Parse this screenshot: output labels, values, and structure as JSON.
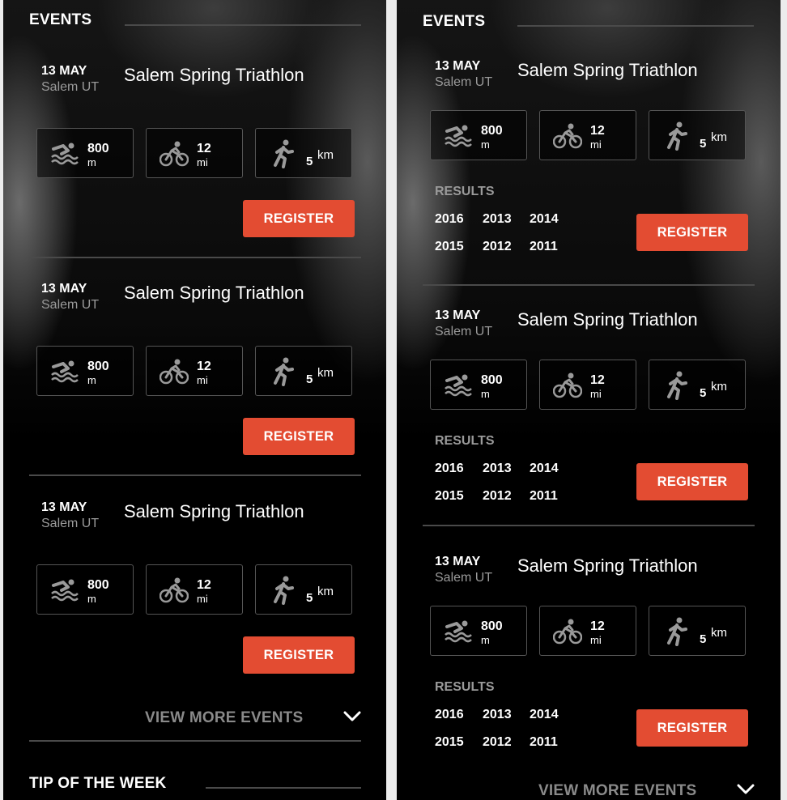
{
  "colors": {
    "accent": "#e34c32",
    "panel_bg": "#000000",
    "muted": "#9a9a9a"
  },
  "icons": {
    "swim": "swim-icon",
    "bike": "bike-icon",
    "run": "run-icon",
    "chevron": "chevron-down-icon"
  },
  "left": {
    "section_title": "EVENTS",
    "events": [
      {
        "date": "13 MAY",
        "location": "Salem UT",
        "title": "Salem Spring Triathlon",
        "swim": {
          "value": "800",
          "unit": "m"
        },
        "bike": {
          "value": "12",
          "unit": "mi"
        },
        "run": {
          "value": "5",
          "unit": "km"
        },
        "register": "REGISTER"
      },
      {
        "date": "13 MAY",
        "location": "Salem UT",
        "title": "Salem Spring Triathlon",
        "swim": {
          "value": "800",
          "unit": "m"
        },
        "bike": {
          "value": "12",
          "unit": "mi"
        },
        "run": {
          "value": "5",
          "unit": "km"
        },
        "register": "REGISTER"
      },
      {
        "date": "13 MAY",
        "location": "Salem UT",
        "title": "Salem Spring Triathlon",
        "swim": {
          "value": "800",
          "unit": "m"
        },
        "bike": {
          "value": "12",
          "unit": "mi"
        },
        "run": {
          "value": "5",
          "unit": "km"
        },
        "register": "REGISTER"
      }
    ],
    "view_more": "VIEW MORE EVENTS",
    "tip_title": "TIP OF THE WEEK"
  },
  "right": {
    "section_title": "EVENTS",
    "events": [
      {
        "date": "13 MAY",
        "location": "Salem UT",
        "title": "Salem Spring Triathlon",
        "swim": {
          "value": "800",
          "unit": "m"
        },
        "bike": {
          "value": "12",
          "unit": "mi"
        },
        "run": {
          "value": "5",
          "unit": "km"
        },
        "results_label": "RESULTS",
        "years": [
          "2016",
          "2013",
          "2014",
          "2015",
          "2012",
          "2011"
        ],
        "register": "REGISTER"
      },
      {
        "date": "13 MAY",
        "location": "Salem UT",
        "title": "Salem Spring Triathlon",
        "swim": {
          "value": "800",
          "unit": "m"
        },
        "bike": {
          "value": "12",
          "unit": "mi"
        },
        "run": {
          "value": "5",
          "unit": "km"
        },
        "results_label": "RESULTS",
        "years": [
          "2016",
          "2013",
          "2014",
          "2015",
          "2012",
          "2011"
        ],
        "register": "REGISTER"
      },
      {
        "date": "13 MAY",
        "location": "Salem UT",
        "title": "Salem Spring Triathlon",
        "swim": {
          "value": "800",
          "unit": "m"
        },
        "bike": {
          "value": "12",
          "unit": "mi"
        },
        "run": {
          "value": "5",
          "unit": "km"
        },
        "results_label": "RESULTS",
        "years": [
          "2016",
          "2013",
          "2014",
          "2015",
          "2012",
          "2011"
        ],
        "register": "REGISTER"
      }
    ],
    "view_more": "VIEW MORE EVENTS"
  }
}
